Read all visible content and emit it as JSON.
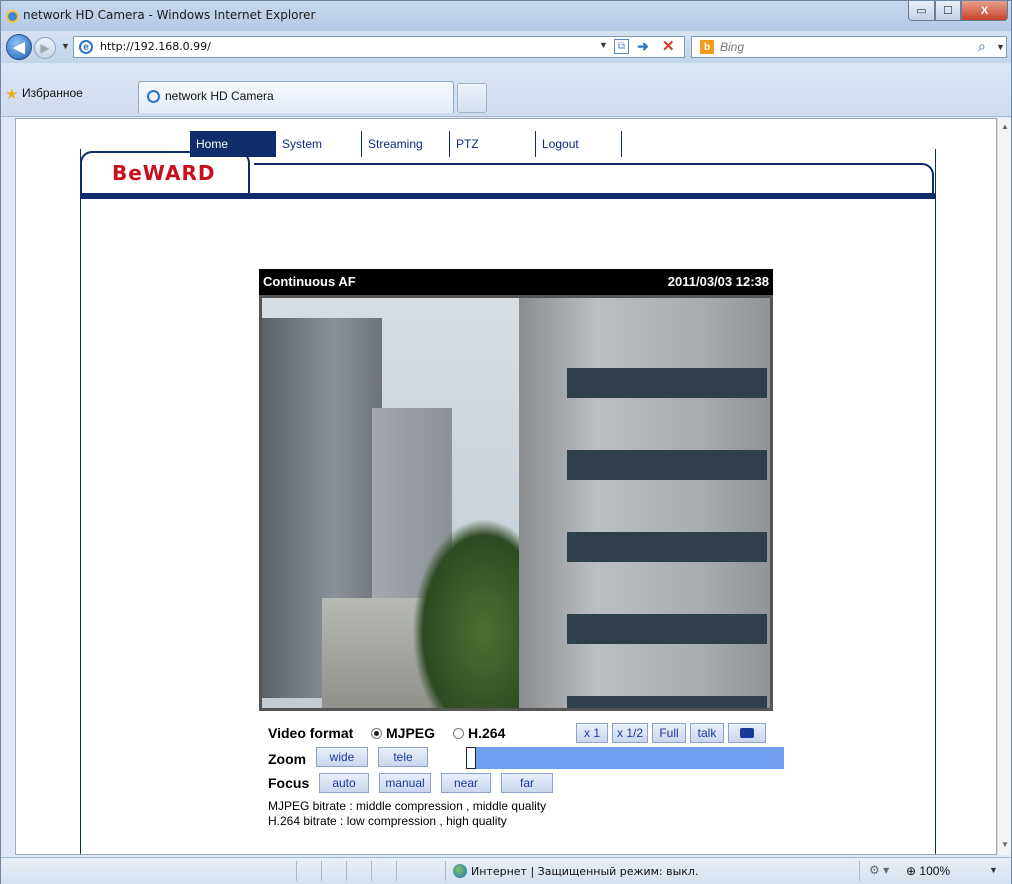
{
  "window": {
    "title": "network HD Camera - Windows Internet Explorer",
    "min_glyph": "▭",
    "max_glyph": "☐",
    "close_glyph": "X"
  },
  "addressbar": {
    "url": "http://192.168.0.99/",
    "search_placeholder": "Bing",
    "search_engine_glyph": "b"
  },
  "favorites": {
    "label": "Избранное",
    "tab_title": "network HD Camera"
  },
  "camera": {
    "logo": "BeWARD",
    "menu": [
      "Home",
      "System",
      "Streaming",
      "PTZ",
      "Logout"
    ],
    "active_menu": "Home",
    "video": {
      "status": "Continuous AF",
      "timestamp": "2011/03/03 12:38"
    },
    "video_format": {
      "label": "Video format",
      "options": [
        "MJPEG",
        "H.264"
      ],
      "selected": "MJPEG"
    },
    "view_buttons": [
      "x 1",
      "x 1/2",
      "Full",
      "talk"
    ],
    "zoom": {
      "label": "Zoom",
      "buttons": [
        "wide",
        "tele"
      ],
      "level": 0.0
    },
    "focus": {
      "label": "Focus",
      "buttons": [
        "auto",
        "manual",
        "near",
        "far"
      ]
    },
    "info": [
      "MJPEG bitrate : middle compression , middle quality",
      "H.264 bitrate : low compression , high quality"
    ]
  },
  "statusbar": {
    "zone_text": "Интернет | Защищенный режим: выкл.",
    "zoom": "100%"
  },
  "colors": {
    "brand_red": "#c6101d",
    "nav_blue": "#0f2c6b",
    "zoom_bar": "#6f9ef0"
  }
}
